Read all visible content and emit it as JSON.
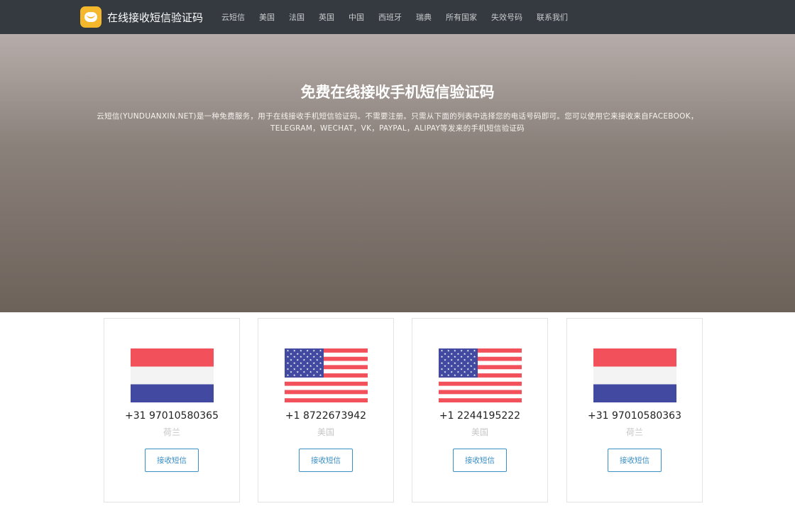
{
  "navbar": {
    "brand_text": "在线接收短信验证码",
    "items": [
      "云短信",
      "美国",
      "法国",
      "英国",
      "中国",
      "西班牙",
      "瑞典",
      "所有国家",
      "失效号码",
      "联系我们"
    ]
  },
  "hero": {
    "title": "免费在线接收手机短信验证码",
    "description": "云短信(YUNDUANXIN.NET)是一种免费服务，用于在线接收手机短信验证码。不需要注册。只需从下面的列表中选择您的电话号码即可。您可以使用它来接收来自FACEBOOK，TELEGRAM，WECHAT，VK，PAYPAL，ALIPAY等发来的手机短信验证码"
  },
  "cards": [
    {
      "flag": "netherlands-flag",
      "phone": "+31 97010580365",
      "country": "荷兰",
      "button": "接收短信"
    },
    {
      "flag": "usa-flag",
      "phone": "+1 8722673942",
      "country": "美国",
      "button": "接收短信"
    },
    {
      "flag": "usa-flag",
      "phone": "+1 2244195222",
      "country": "美国",
      "button": "接收短信"
    },
    {
      "flag": "netherlands-flag",
      "phone": "+31 97010580363",
      "country": "荷兰",
      "button": "接收短信"
    }
  ],
  "colors": {
    "navbar_bg": "#343a40",
    "brand_logo": "#f5b72b",
    "flag_red": "#f2505a",
    "flag_blue": "#414aa0",
    "flag_white": "#f3f3f3",
    "button_accent": "#3a8fc4"
  }
}
